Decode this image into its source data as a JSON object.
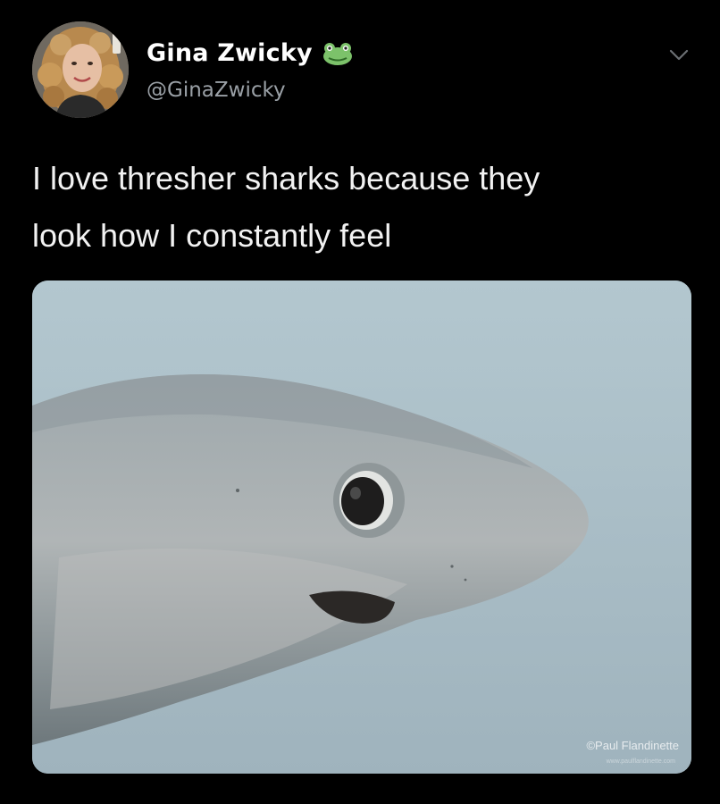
{
  "tweet": {
    "author": {
      "display_name": "Gina Zwicky",
      "handle": "@GinaZwicky",
      "name_emoji_icon": "frog-face-icon",
      "avatar_icon": "profile-photo"
    },
    "menu_icon": "chevron-down-icon",
    "text_lines": [
      "I love thresher sharks because they",
      "look how I constantly feel"
    ],
    "media": {
      "subject": "thresher shark close-up",
      "watermark": "©Paul Flandinette",
      "watermark_url": "www.paulflandinette.com"
    }
  },
  "colors": {
    "background": "#000000",
    "text": "#ffffff",
    "handle": "#9aa0a6",
    "water": "#a9bcc5"
  }
}
